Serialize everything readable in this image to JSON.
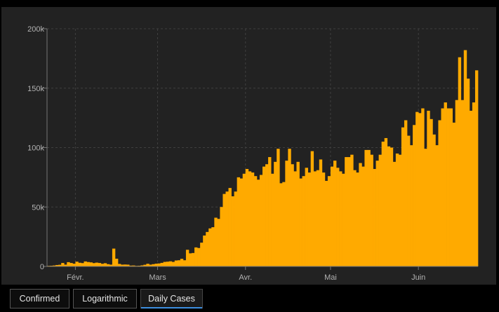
{
  "tabs": [
    {
      "label": "Confirmed",
      "active": false
    },
    {
      "label": "Logarithmic",
      "active": false
    },
    {
      "label": "Daily Cases",
      "active": true
    }
  ],
  "colors": {
    "bar": "#FFAA00",
    "plot_background": "#222222",
    "grid": "#3f3f3f",
    "tab_active_underline": "#3d8fe0"
  },
  "chart_data": {
    "type": "bar",
    "ylim": [
      0,
      200000
    ],
    "yticks": [
      {
        "value": 0,
        "label": "0"
      },
      {
        "value": 50000,
        "label": "50k"
      },
      {
        "value": 100000,
        "label": "100k"
      },
      {
        "value": 150000,
        "label": "150k"
      },
      {
        "value": 200000,
        "label": "200k"
      }
    ],
    "xticks": [
      {
        "date": "2020-02-01",
        "label": "Févr."
      },
      {
        "date": "2020-03-01",
        "label": "Mars"
      },
      {
        "date": "2020-04-01",
        "label": "Avr."
      },
      {
        "date": "2020-05-01",
        "label": "Mai"
      },
      {
        "date": "2020-06-01",
        "label": "Juin"
      }
    ],
    "grid": true,
    "start_date": "2020-01-22",
    "values": [
      500,
      600,
      800,
      1200,
      1400,
      2900,
      1500,
      3600,
      2900,
      2300,
      4000,
      3100,
      2800,
      4200,
      3700,
      3400,
      2800,
      3200,
      2900,
      2200,
      2700,
      1900,
      1500,
      15000,
      6500,
      2100,
      1500,
      1600,
      1500,
      700,
      800,
      500,
      600,
      900,
      1400,
      2200,
      1500,
      1900,
      2300,
      2500,
      3000,
      3800,
      4000,
      4300,
      3800,
      5000,
      5200,
      6400,
      5200,
      14000,
      11000,
      11300,
      16000,
      15500,
      20000,
      26000,
      29000,
      32000,
      33000,
      41000,
      40000,
      50000,
      61000,
      63000,
      66000,
      59000,
      63000,
      75000,
      74000,
      78000,
      82000,
      80000,
      79000,
      76000,
      73000,
      77000,
      84000,
      86000,
      92000,
      78000,
      88000,
      99000,
      70000,
      71000,
      89000,
      99000,
      86000,
      80000,
      88000,
      74000,
      76000,
      83000,
      79000,
      97000,
      80000,
      81000,
      90000,
      79000,
      72000,
      76000,
      84000,
      89000,
      83000,
      80000,
      78000,
      92000,
      92000,
      94000,
      81000,
      79000,
      87000,
      84000,
      98000,
      98000,
      94000,
      82000,
      89000,
      94000,
      105000,
      108000,
      101000,
      100000,
      88000,
      95000,
      94000,
      117000,
      123000,
      110000,
      102000,
      119000,
      130000,
      129000,
      133000,
      99000,
      131000,
      124000,
      111000,
      102000,
      123000,
      133000,
      138000,
      133000,
      133000,
      121000,
      140000,
      176000,
      140000,
      182000,
      158000,
      131000,
      138000,
      165000
    ]
  }
}
